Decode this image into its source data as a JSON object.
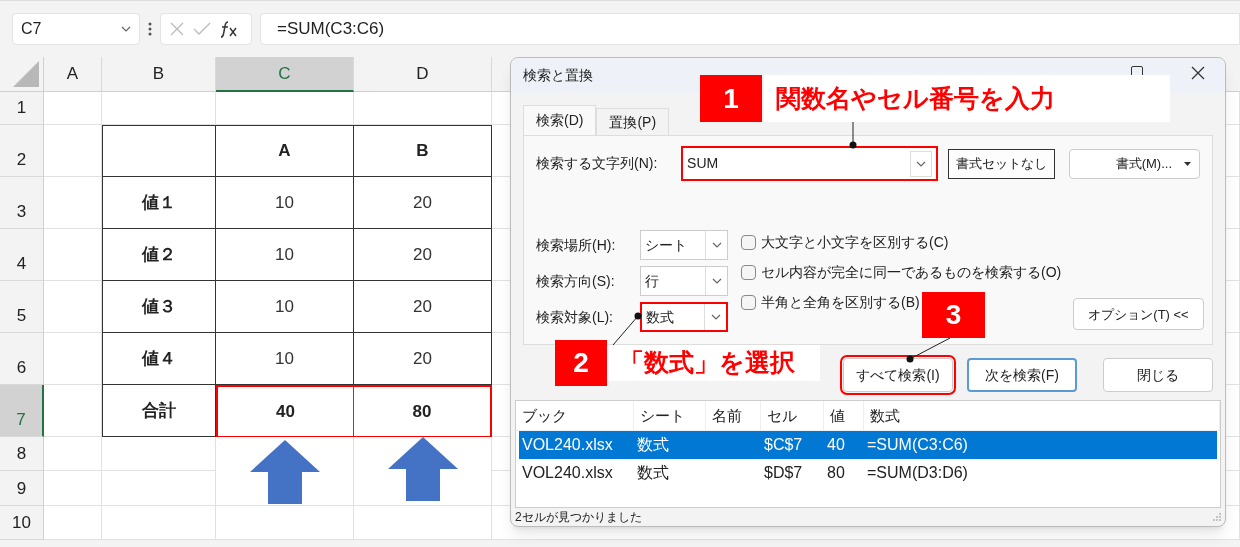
{
  "formula_bar": {
    "name_box": "C7",
    "formula": "=SUM(C3:C6)"
  },
  "sheet": {
    "columns": [
      {
        "label": "A",
        "selected": false
      },
      {
        "label": "B",
        "selected": false
      },
      {
        "label": "C",
        "selected": true
      },
      {
        "label": "D",
        "selected": false
      }
    ],
    "row_headers": [
      {
        "label": "1",
        "selected": false
      },
      {
        "label": "2",
        "selected": false
      },
      {
        "label": "3",
        "selected": false
      },
      {
        "label": "4",
        "selected": false
      },
      {
        "label": "5",
        "selected": false
      },
      {
        "label": "6",
        "selected": false
      },
      {
        "label": "7",
        "selected": true
      },
      {
        "label": "8",
        "selected": false
      },
      {
        "label": "9",
        "selected": false
      },
      {
        "label": "10",
        "selected": false
      }
    ],
    "table": {
      "columns": [
        "A",
        "B"
      ],
      "rows": [
        {
          "label": "値１",
          "values": [
            "10",
            "20"
          ],
          "kind": "value",
          "highlighted": false
        },
        {
          "label": "値２",
          "values": [
            "10",
            "20"
          ],
          "kind": "value",
          "highlighted": false
        },
        {
          "label": "値３",
          "values": [
            "10",
            "20"
          ],
          "kind": "value",
          "highlighted": false
        },
        {
          "label": "値４",
          "values": [
            "10",
            "20"
          ],
          "kind": "value",
          "highlighted": false
        },
        {
          "label": "合計",
          "values": [
            "40",
            "80"
          ],
          "kind": "total",
          "highlighted": true
        }
      ]
    }
  },
  "dialog": {
    "title": "検索と置換",
    "tabs": [
      {
        "label": "検索(D)",
        "selected": true
      },
      {
        "label": "置換(P)",
        "selected": false
      }
    ],
    "find": {
      "label": "検索する文字列(N):",
      "value": "SUM",
      "highlighted": true
    },
    "no_format_button": "書式セットなし",
    "format_button": "書式(M)...",
    "options": [
      {
        "label": "検索場所(H):",
        "value": "シート",
        "highlighted": false
      },
      {
        "label": "検索方向(S):",
        "value": "行",
        "highlighted": false
      },
      {
        "label": "検索対象(L):",
        "value": "数式",
        "highlighted": true
      }
    ],
    "checkboxes": [
      {
        "label": "大文字と小文字を区別する(C)",
        "checked": false
      },
      {
        "label": "セル内容が完全に同一であるものを検索する(O)",
        "checked": false
      },
      {
        "label": "半角と全角を区別する(B)",
        "checked": false
      }
    ],
    "options_button": "オプション(T) <<",
    "buttons": [
      {
        "label": "すべて検索(I)",
        "default": false,
        "highlighted": true
      },
      {
        "label": "次を検索(F)",
        "default": true,
        "highlighted": false
      },
      {
        "label": "閉じる",
        "default": false,
        "highlighted": false
      }
    ],
    "results": {
      "columns": [
        "ブック",
        "シート",
        "名前",
        "セル",
        "値",
        "数式"
      ],
      "rows": [
        {
          "cells": [
            "VOL240.xlsx",
            "数式",
            "",
            "$C$7",
            "40",
            "=SUM(C3:C6)"
          ],
          "selected": true
        },
        {
          "cells": [
            "VOL240.xlsx",
            "数式",
            "",
            "$D$7",
            "80",
            "=SUM(D3:D6)"
          ],
          "selected": false
        }
      ]
    },
    "status": "2セルが見つかりました"
  },
  "callouts": [
    {
      "number": "1",
      "text": "関数名やセル番号を入力"
    },
    {
      "number": "2",
      "text": "「数式」を選択"
    },
    {
      "number": "3"
    }
  ]
}
